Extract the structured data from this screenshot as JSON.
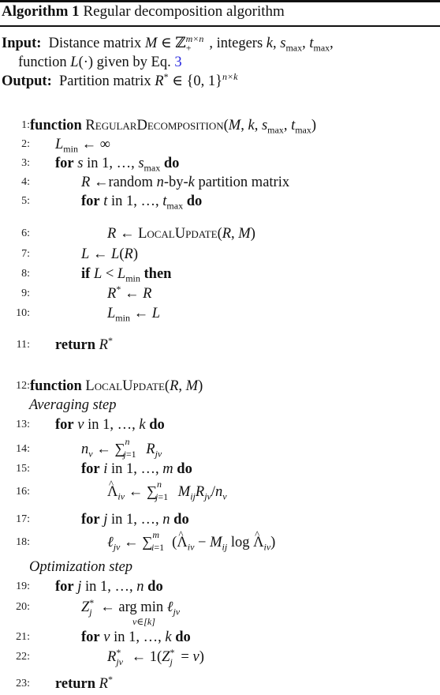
{
  "caption": {
    "label": "Algorithm 1",
    "title": "Regular decomposition algorithm"
  },
  "input": {
    "label": "Input:",
    "text_line1": "Distance matrix M ∈ ℤ₊^{m×n}, integers k, s_max, t_max,",
    "text_line2_prefix": "function L(·) given by Eq.",
    "eq_ref": "3"
  },
  "output": {
    "label": "Output:",
    "text": "Partition matrix R* ∈ {0,1}^{n×k}"
  },
  "link_color": "#2a2ae0",
  "lines": [
    {
      "no": "1:",
      "text": "function REGULARDECOMPOSITION(M, k, s_max, t_max)"
    },
    {
      "no": "2:",
      "text": "L_min ← ∞"
    },
    {
      "no": "3:",
      "text": "for s in 1, …, s_max do"
    },
    {
      "no": "4:",
      "text": "R ←random n-by-k partition matrix"
    },
    {
      "no": "5:",
      "text": "for t in 1, …, t_max do"
    },
    {
      "no": "6:",
      "text": "R ← LOCALUPDATE(R, M)"
    },
    {
      "no": "7:",
      "text": "L ← L(R)"
    },
    {
      "no": "8:",
      "text": "if L < L_min then"
    },
    {
      "no": "9:",
      "text": "R* ← R"
    },
    {
      "no": "10:",
      "text": "L_min ← L"
    },
    {
      "no": "11:",
      "text": "return R*"
    },
    {
      "no": "12:",
      "text": "function LOCALUPDATE(R, M)"
    },
    {
      "no": "13:",
      "text": "for v in 1, …, k do"
    },
    {
      "no": "14:",
      "text": "n_v ← Σ_{j=1}^{n} R_{jv}"
    },
    {
      "no": "15:",
      "text": "for i in 1, …, m do"
    },
    {
      "no": "16:",
      "text": "Λ̂_{iv} ← Σ_{j=1}^{n} M_{ij} R_{jv} / n_v"
    },
    {
      "no": "17:",
      "text": "for j in 1, …, n do"
    },
    {
      "no": "18:",
      "text": "ℓ_{jv} ← Σ_{i=1}^{m} (Λ̂_{iv} − M_{ij} log Λ̂_{iv})"
    },
    {
      "no": "19:",
      "text": "for j in 1, …, n do"
    },
    {
      "no": "20:",
      "text": "Z*_j ← arg min_{v∈[k]} ℓ_{jv}"
    },
    {
      "no": "21:",
      "text": "for v in 1, …, k do"
    },
    {
      "no": "22:",
      "text": "R*_{jv} ← 1(Z*_j = v)"
    },
    {
      "no": "23:",
      "text": "return R*"
    }
  ],
  "comments": {
    "averaging": "Averaging step",
    "optimization": "Optimization step"
  },
  "tokens": {
    "function": "function",
    "for": "for",
    "do": "do",
    "if": "if",
    "then": "then",
    "return": "return",
    "in": "in",
    "regular_decomposition": "RegularDecomposition",
    "local_update": "LocalUpdate",
    "random_text": "random",
    "partition_matrix": "partition matrix",
    "by": "-by-",
    "argmin": "arg min",
    "log": "log",
    "argmin_under": "v∈[k]"
  }
}
